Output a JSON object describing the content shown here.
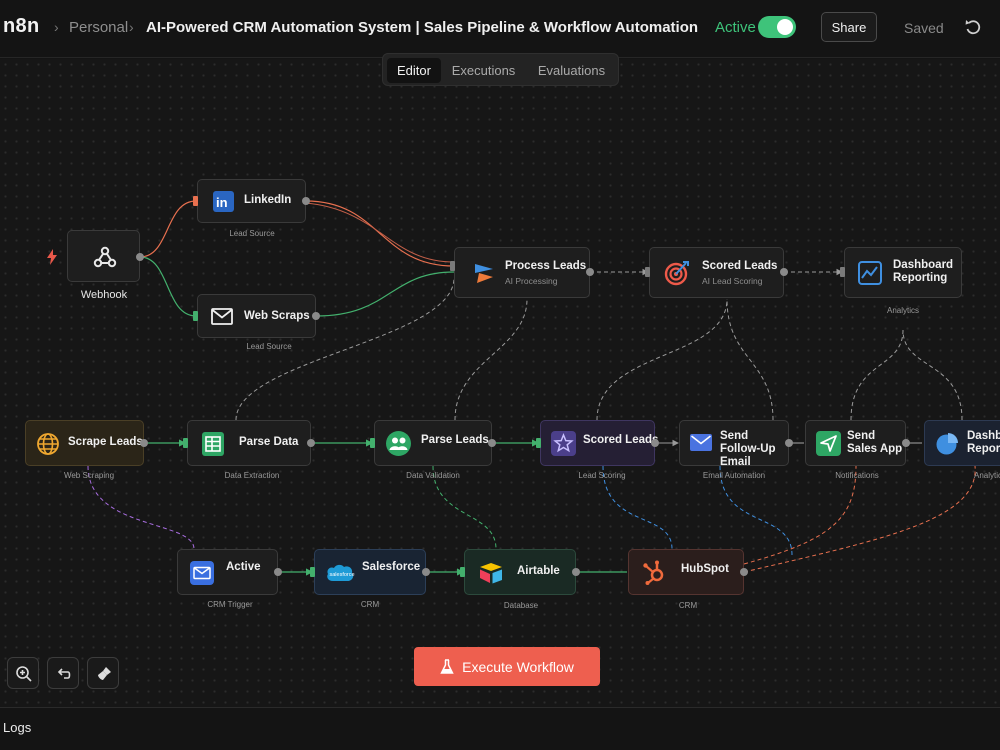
{
  "app": {
    "logo": "n8n"
  },
  "breadcrumb": {
    "parent": "Personal",
    "title": "AI-Powered CRM Automation System | Sales Pipeline & Workflow Automation"
  },
  "header": {
    "active_label": "Active",
    "active_state": true,
    "share_label": "Share",
    "saved_label": "Saved",
    "undo_icon": "undo-icon"
  },
  "tabs": [
    {
      "label": "Editor",
      "active": true
    },
    {
      "label": "Executions",
      "active": false
    },
    {
      "label": "Evaluations",
      "active": false
    }
  ],
  "nodes": {
    "webhook": {
      "title": "Webhook",
      "icon": "webhook-icon"
    },
    "linkedin": {
      "title": "LinkedIn",
      "caption": "Lead Source",
      "icon": "linkedin-icon"
    },
    "web_scraps": {
      "title": "Web Scraps",
      "caption": "Lead Source",
      "icon": "mail-icon"
    },
    "process_leads": {
      "title": "Process Leads",
      "subtitle": "AI Processing",
      "icon": "ai-processing-icon"
    },
    "scored_leads_top": {
      "title": "Scored Leads",
      "subtitle": "AI Lead Scoring",
      "icon": "target-icon"
    },
    "dashboard_top": {
      "title": "Dashboard Reporting",
      "caption": "Analytics",
      "icon": "chart-icon"
    },
    "scrape_leads": {
      "title": "Scrape Leads",
      "caption": "Web Scraping",
      "icon": "globe-icon"
    },
    "parse_data": {
      "title": "Parse Data",
      "caption": "Data Extraction",
      "icon": "sheet-icon"
    },
    "parse_leads": {
      "title": "Parse Leads",
      "caption": "Data Validation",
      "icon": "users-icon"
    },
    "scored_leads_mid": {
      "title": "Scored Leads",
      "caption": "Lead Scoring",
      "icon": "star-icon"
    },
    "send_followup": {
      "title": "Send Follow-Up Email",
      "caption": "Email Automation",
      "icon": "mail-icon"
    },
    "send_sales_app": {
      "title": "Send Sales App",
      "caption": "Notifications",
      "icon": "send-icon"
    },
    "dashboard_right": {
      "title": "Dashboard Reporting",
      "caption": "Analytics",
      "icon": "pie-icon"
    },
    "active_trigger": {
      "title": "Active",
      "caption": "CRM Trigger",
      "icon": "mail-icon"
    },
    "salesforce": {
      "title": "Salesforce",
      "caption": "CRM",
      "icon": "salesforce-icon"
    },
    "airtable": {
      "title": "Airtable",
      "caption": "Database",
      "icon": "airtable-icon"
    },
    "hubspot": {
      "title": "HubSpot",
      "caption": "CRM",
      "icon": "hubspot-icon"
    }
  },
  "toolbar": {
    "zoom_icon": "zoom-in-icon",
    "undo_icon": "undo-icon",
    "clean_icon": "brush-icon"
  },
  "execute": {
    "label": "Execute Workflow",
    "icon": "flask-icon"
  },
  "logs": {
    "label": "Logs"
  },
  "colors": {
    "accent_green": "#3ec37a",
    "execute_red": "#ee5f4f",
    "edge_orange": "#e8704f",
    "edge_green": "#43b06d",
    "edge_purple": "#a86de0",
    "edge_blue": "#3f8fe0",
    "linkedin_blue": "#2a66c2",
    "hubspot_orange": "#f06a3c"
  }
}
